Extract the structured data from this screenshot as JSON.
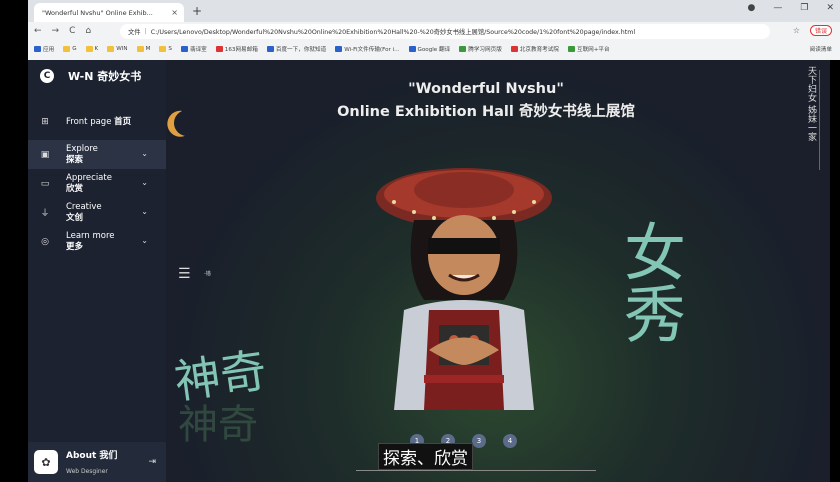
{
  "browser": {
    "tab_title": "\"Wonderful Nvshu\" Online Exhib...",
    "tab_close": "×",
    "new_tab": "+",
    "window_controls": [
      "●",
      "—",
      "❐",
      "✕"
    ],
    "nav_buttons": [
      "←",
      "→",
      "C",
      "⌂"
    ],
    "url_scheme": "文件",
    "url": "C:/Users/Lenovo/Desktop/Wonderful%20Nvshu%20Online%20Exhibition%20Hall%20-%20奇妙女书线上展馆/Source%20code/1%20font%20page/index.html",
    "star": "☆",
    "error_badge": "错误",
    "bookmarks": [
      "应用",
      "G",
      "K",
      "WIN",
      "M",
      "S",
      "翡译室",
      "163网易邮箱",
      "百度一下，你就知道",
      "Wi-Fi文件传输(For i...",
      "Google 翻译",
      "腾学习网页版",
      "北京教育考试院",
      "互联网+平台"
    ],
    "bookmarks_right": "阅读清单"
  },
  "sidebar": {
    "brand": "W-N 奇妙女书",
    "brand_icon": "C",
    "items": [
      {
        "en": "Front page",
        "zh": "首页",
        "icon": "grid-icon"
      },
      {
        "en": "Explore",
        "zh": "探索",
        "icon": "lock-icon"
      },
      {
        "en": "Appreciate",
        "zh": "欣赏",
        "icon": "monitor-icon"
      },
      {
        "en": "Creative",
        "zh": "文创",
        "icon": "plug-icon"
      },
      {
        "en": "Learn more",
        "zh": "更多",
        "icon": "compass-icon"
      }
    ],
    "about_title": "About 我们",
    "about_sub": "Web Desginer"
  },
  "main": {
    "title_line1": "\"Wonderful Nvshu\"",
    "title_line2": "Online Exhibition Hall 奇妙女书线上展馆",
    "vertical_text": "天下妇女 姊妹一家",
    "hamburger_label": "-锚",
    "big_chars_left": "神奇",
    "big_chars_right": "女秀",
    "slides": [
      "1",
      "2",
      "3",
      "4"
    ],
    "caption": "探索、欣赏"
  },
  "colors": {
    "sidebar_bg": "#1c2230",
    "accent_green": "#8fd7c5",
    "moon": "#e0a040"
  }
}
